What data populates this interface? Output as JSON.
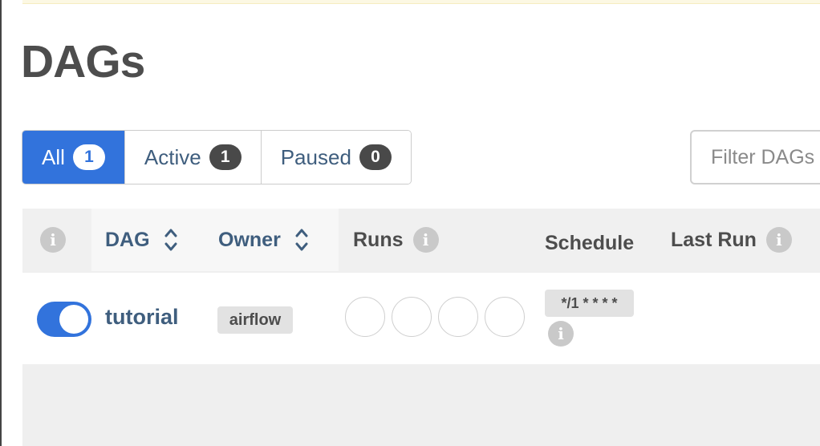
{
  "page": {
    "title": "DAGs"
  },
  "filters": {
    "tabs": [
      {
        "label": "All",
        "count": "1"
      },
      {
        "label": "Active",
        "count": "1"
      },
      {
        "label": "Paused",
        "count": "0"
      }
    ],
    "search_placeholder": "Filter DAGs"
  },
  "table": {
    "headers": {
      "info": "i",
      "dag": "DAG",
      "owner": "Owner",
      "runs": "Runs",
      "schedule": "Schedule",
      "last_run": "Last Run"
    },
    "rows": [
      {
        "paused": false,
        "dag_id": "tutorial",
        "owner": "airflow",
        "runs_state_count": 4,
        "schedule": "*/1 * * * *",
        "schedule_info": "i"
      }
    ]
  },
  "colors": {
    "accent": "#3273dc",
    "link": "#3f5e7e",
    "banner": "#fcf8e3"
  },
  "icons": {
    "sort": "sort-updown-icon",
    "info": "info-circle-icon"
  }
}
